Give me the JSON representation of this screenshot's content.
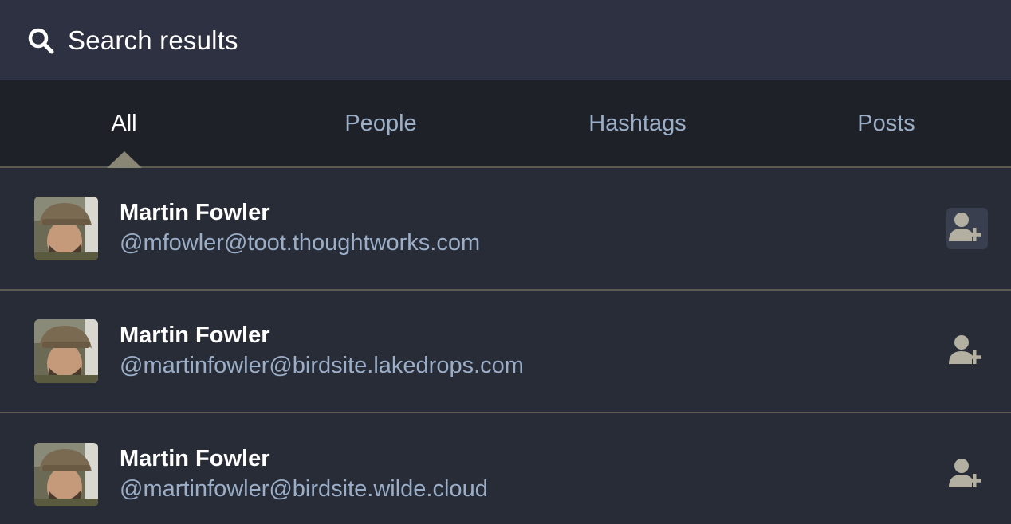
{
  "header": {
    "title": "Search results",
    "icon": "search-icon"
  },
  "tabs": [
    {
      "label": "All",
      "active": true
    },
    {
      "label": "People",
      "active": false
    },
    {
      "label": "Hashtags",
      "active": false
    },
    {
      "label": "Posts",
      "active": false
    }
  ],
  "results": [
    {
      "name": "Martin Fowler",
      "handle": "@mfowler@toot.thoughtworks.com",
      "action_icon": "add-user-icon"
    },
    {
      "name": "Martin Fowler",
      "handle": "@martinfowler@birdsite.lakedrops.com",
      "action_icon": "add-user-icon"
    },
    {
      "name": "Martin Fowler",
      "handle": "@martinfowler@birdsite.wilde.cloud",
      "action_icon": "add-user-icon"
    }
  ],
  "colors": {
    "background": "#282c37",
    "header": "#2e3141",
    "tabs_bg": "#1f2128",
    "handle": "#9baec8",
    "follow_icon": "#b4b0a1"
  }
}
